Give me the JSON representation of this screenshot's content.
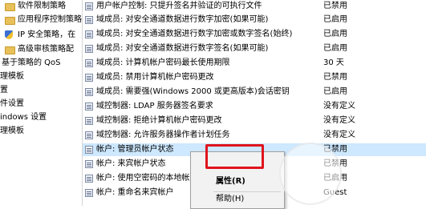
{
  "tree": {
    "items": [
      {
        "label": "软件限制策略",
        "icon": "folder-icon"
      },
      {
        "label": "应用程序控制策略",
        "icon": "folder-icon"
      },
      {
        "label": "IP 安全策略，在",
        "icon": "ip-security-icon"
      },
      {
        "label": "高级审核策略配",
        "icon": "folder-icon"
      },
      {
        "label": "基于策略的 QoS",
        "icon": ""
      },
      {
        "label": "理模板",
        "icon": ""
      },
      {
        "label": "置",
        "icon": ""
      },
      {
        "label": "件设置",
        "icon": ""
      },
      {
        "label": "indows 设置",
        "icon": ""
      },
      {
        "label": "理模板",
        "icon": ""
      }
    ]
  },
  "policies": {
    "rows": [
      {
        "name": "用户帐户控制: 只提升签名并验证的可执行文件",
        "status": "已禁用"
      },
      {
        "name": "域成员: 对安全通道数据进行数字加密(如果可能)",
        "status": "已启用"
      },
      {
        "name": "域成员: 对安全通道数据进行数字加密或数字签名(始终)",
        "status": "已启用"
      },
      {
        "name": "域成员: 对安全通道数据进行数字签名(如果可能)",
        "status": "已启用"
      },
      {
        "name": "域成员: 计算机帐户密码最长使用期限",
        "status": "30 天"
      },
      {
        "name": "域成员: 禁用计算机帐户密码更改",
        "status": "已禁用"
      },
      {
        "name": "域成员: 需要强(Windows 2000 或更高版本)会话密钥",
        "status": "已启用"
      },
      {
        "name": "域控制器: LDAP 服务器签名要求",
        "status": "没有定义"
      },
      {
        "name": "域控制器: 拒绝计算机帐户密码更改",
        "status": "没有定义"
      },
      {
        "name": "域控制器: 允许服务器操作者计划任务",
        "status": "没有定义"
      },
      {
        "name": "帐户: 管理员帐户状态",
        "status": "已禁用"
      },
      {
        "name": "帐户: 来宾帐户状态",
        "status": "已禁用"
      },
      {
        "name": "帐户: 使用空密码的本地帐",
        "status": "已启用"
      },
      {
        "name": "帐户: 重命名来宾帐户",
        "status": "Guest"
      }
    ]
  },
  "context_menu": {
    "items": [
      {
        "label": "属性(R)"
      },
      {
        "label": "帮助(H)"
      }
    ]
  },
  "colors": {
    "selection": "#cde8ff",
    "highlight_box": "#e0141e"
  }
}
